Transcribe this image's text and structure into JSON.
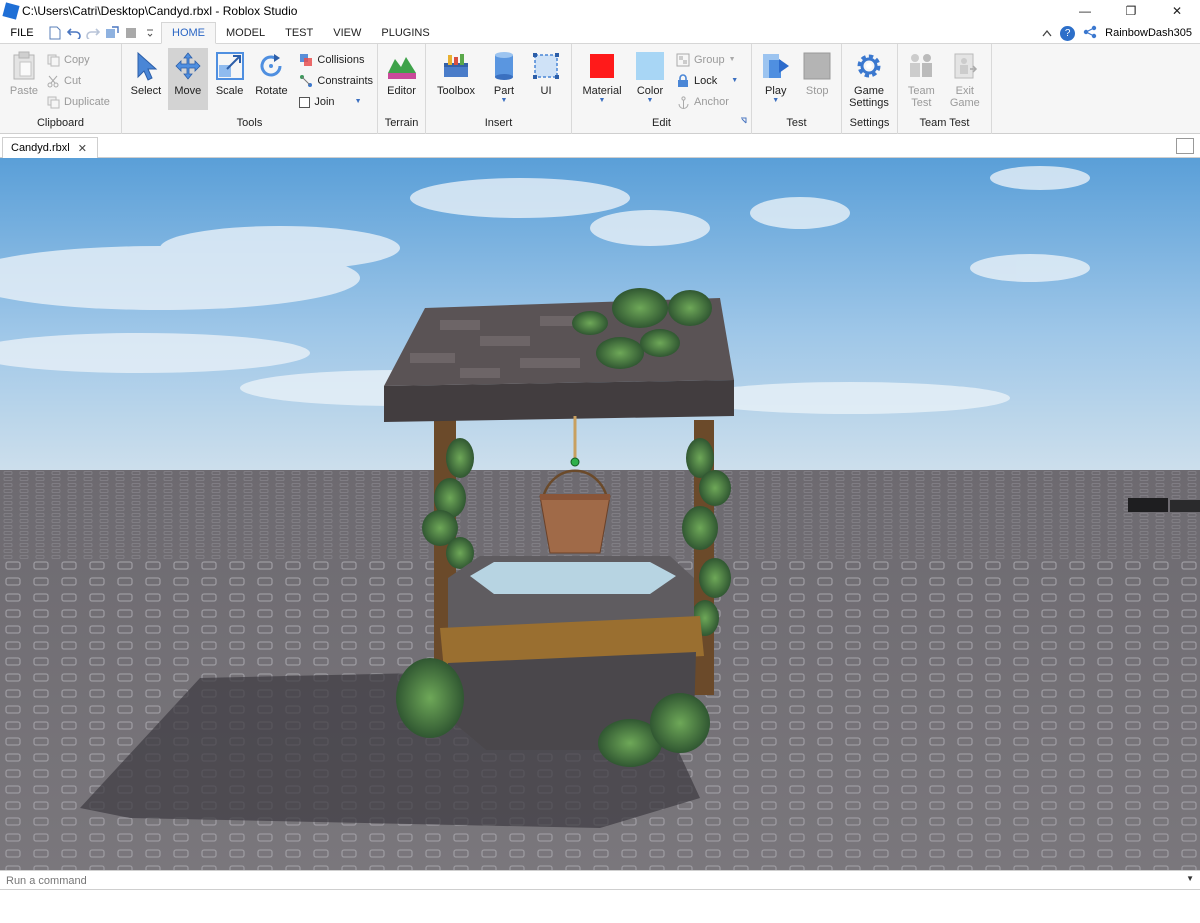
{
  "window": {
    "title": "C:\\Users\\Catri\\Desktop\\Candyd.rbxl - Roblox Studio",
    "minimize_glyph": "—",
    "restore_glyph": "❐",
    "close_glyph": "✕"
  },
  "menu": {
    "file_label": "FILE",
    "tabs": [
      {
        "label": "HOME",
        "active": true
      },
      {
        "label": "MODEL",
        "active": false
      },
      {
        "label": "TEST",
        "active": false
      },
      {
        "label": "VIEW",
        "active": false
      },
      {
        "label": "PLUGINS",
        "active": false
      }
    ],
    "help_glyph": "?",
    "username": "RainbowDash305"
  },
  "ribbon": {
    "clipboard": {
      "label": "Clipboard",
      "paste": "Paste",
      "copy": "Copy",
      "cut": "Cut",
      "duplicate": "Duplicate"
    },
    "tools": {
      "label": "Tools",
      "select": "Select",
      "move": "Move",
      "scale": "Scale",
      "rotate": "Rotate",
      "collisions": "Collisions",
      "constraints": "Constraints",
      "join": "Join"
    },
    "terrain": {
      "label": "Terrain",
      "editor": "Editor"
    },
    "insert": {
      "label": "Insert",
      "toolbox": "Toolbox",
      "part": "Part",
      "ui": "UI"
    },
    "edit": {
      "label": "Edit",
      "material": "Material",
      "color": "Color",
      "group": "Group",
      "lock": "Lock",
      "anchor": "Anchor",
      "material_color": "#ff1a1a",
      "color_swatch": "#a8d6f5"
    },
    "test": {
      "label": "Test",
      "play": "Play",
      "stop": "Stop"
    },
    "settings": {
      "label": "Settings",
      "game_settings_line1": "Game",
      "game_settings_line2": "Settings"
    },
    "team_test": {
      "label": "Team Test",
      "team_test_line1": "Team",
      "team_test_line2": "Test",
      "exit_game_line1": "Exit",
      "exit_game_line2": "Game"
    }
  },
  "document": {
    "tab_label": "Candyd.rbxl",
    "close_glyph": "✕"
  },
  "command_bar": {
    "placeholder": "Run a command"
  }
}
